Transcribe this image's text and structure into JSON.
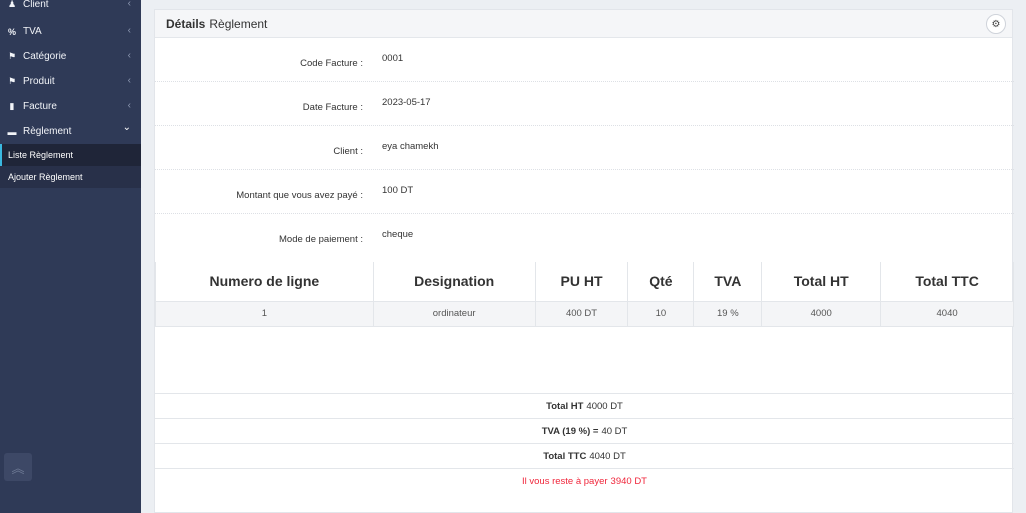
{
  "sidebar": {
    "items": [
      {
        "label": "Client",
        "icon": "user-icon",
        "glyph": "♟",
        "chev": "‹"
      },
      {
        "label": "TVA",
        "icon": "percent-icon",
        "glyph": "%",
        "chev": "‹"
      },
      {
        "label": "Catégorie",
        "icon": "category-icon",
        "glyph": "⚑",
        "chev": "‹"
      },
      {
        "label": "Produit",
        "icon": "product-icon",
        "glyph": "⚑",
        "chev": "‹"
      },
      {
        "label": "Facture",
        "icon": "invoice-icon",
        "glyph": "▮",
        "chev": "‹"
      },
      {
        "label": "Règlement",
        "icon": "credit-card-icon",
        "glyph": "▬",
        "chev": "⌄"
      }
    ],
    "sub_items": [
      {
        "label": "Liste Règlement",
        "active": true
      },
      {
        "label": "Ajouter Règlement",
        "active": false
      }
    ],
    "scroll_top_glyph": "︽"
  },
  "header": {
    "title_bold": "Détails",
    "title_rest": "Règlement",
    "gear_glyph": "⚙"
  },
  "details": [
    {
      "label": "Code Facture :",
      "value": "0001"
    },
    {
      "label": "Date Facture :",
      "value": "2023-05-17"
    },
    {
      "label": "Client :",
      "value": "eya chamekh"
    },
    {
      "label": "Montant que vous avez payé :",
      "value": "100 DT"
    },
    {
      "label": "Mode de paiement :",
      "value": "cheque"
    }
  ],
  "table": {
    "headers": [
      "Numero de ligne",
      "Designation",
      "PU HT",
      "Qté",
      "TVA",
      "Total HT",
      "Total TTC"
    ],
    "rows": [
      [
        "1",
        "ordinateur",
        "400 DT",
        "10",
        "19 %",
        "4000",
        "4040"
      ]
    ]
  },
  "totals": {
    "ht_label": "Total HT",
    "ht_value": "4000 DT",
    "tva_label": "TVA (19 %) =",
    "tva_value": "40 DT",
    "ttc_label": "Total TTC",
    "ttc_value": "4040 DT",
    "rest_label": "Il vous reste à payer",
    "rest_value": "3940 DT"
  },
  "colors": {
    "sidebar_bg": "#2f3a57",
    "active_accent": "#3ab8e0",
    "rest_text": "#f0263b"
  }
}
